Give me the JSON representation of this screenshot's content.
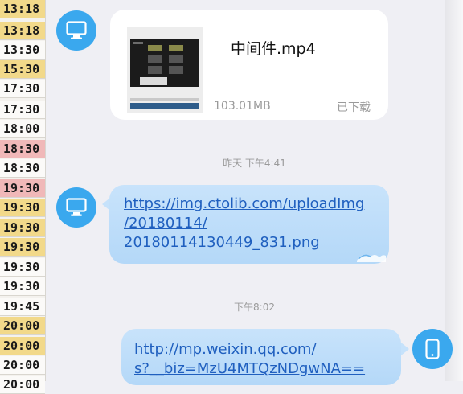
{
  "timeline": {
    "rows": [
      {
        "time": "13:18",
        "style": "yellow"
      },
      {
        "time": "13:18",
        "style": "yellow"
      },
      {
        "time": "13:30",
        "style": "white"
      },
      {
        "time": "15:30",
        "style": "yellow"
      },
      {
        "time": "17:30",
        "style": "white"
      },
      {
        "time": "17:30",
        "style": "white"
      },
      {
        "time": "18:00",
        "style": "white"
      },
      {
        "time": "18:30",
        "style": "red"
      },
      {
        "time": "18:30",
        "style": "white"
      },
      {
        "time": "19:30",
        "style": "red"
      },
      {
        "time": "19:30",
        "style": "yellow"
      },
      {
        "time": "19:30",
        "style": "yellow"
      },
      {
        "time": "19:30",
        "style": "yellow"
      },
      {
        "time": "19:30",
        "style": "white"
      },
      {
        "time": "19:30",
        "style": "white"
      },
      {
        "time": "19:45",
        "style": "white"
      },
      {
        "time": "20:00",
        "style": "yellow"
      },
      {
        "time": "20:00",
        "style": "yellow"
      },
      {
        "time": "20:00",
        "style": "white"
      },
      {
        "time": "20:00",
        "style": "white"
      }
    ]
  },
  "messages": {
    "file": {
      "name": "中间件.mp4",
      "size": "103.01MB",
      "status": "已下载"
    },
    "timestamp1": "昨天 下午4:41",
    "link1": {
      "lines": [
        "https://img.ctolib.com/uploadImg",
        "/20180114/",
        "20180114130449_831.png"
      ]
    },
    "timestamp2": "下午8:02",
    "link2": {
      "lines": [
        "http://mp.weixin.qq.com/",
        "s?__biz=MzU4MTQzNDgwNA=="
      ]
    }
  },
  "colors": {
    "avatar": "#3aa8ee",
    "bubble": "#c8e3fb",
    "link": "#1f5fbf"
  },
  "icons": {
    "sender_avatar": "desktop-monitor-icon",
    "receiver_avatar": "phone-icon"
  }
}
